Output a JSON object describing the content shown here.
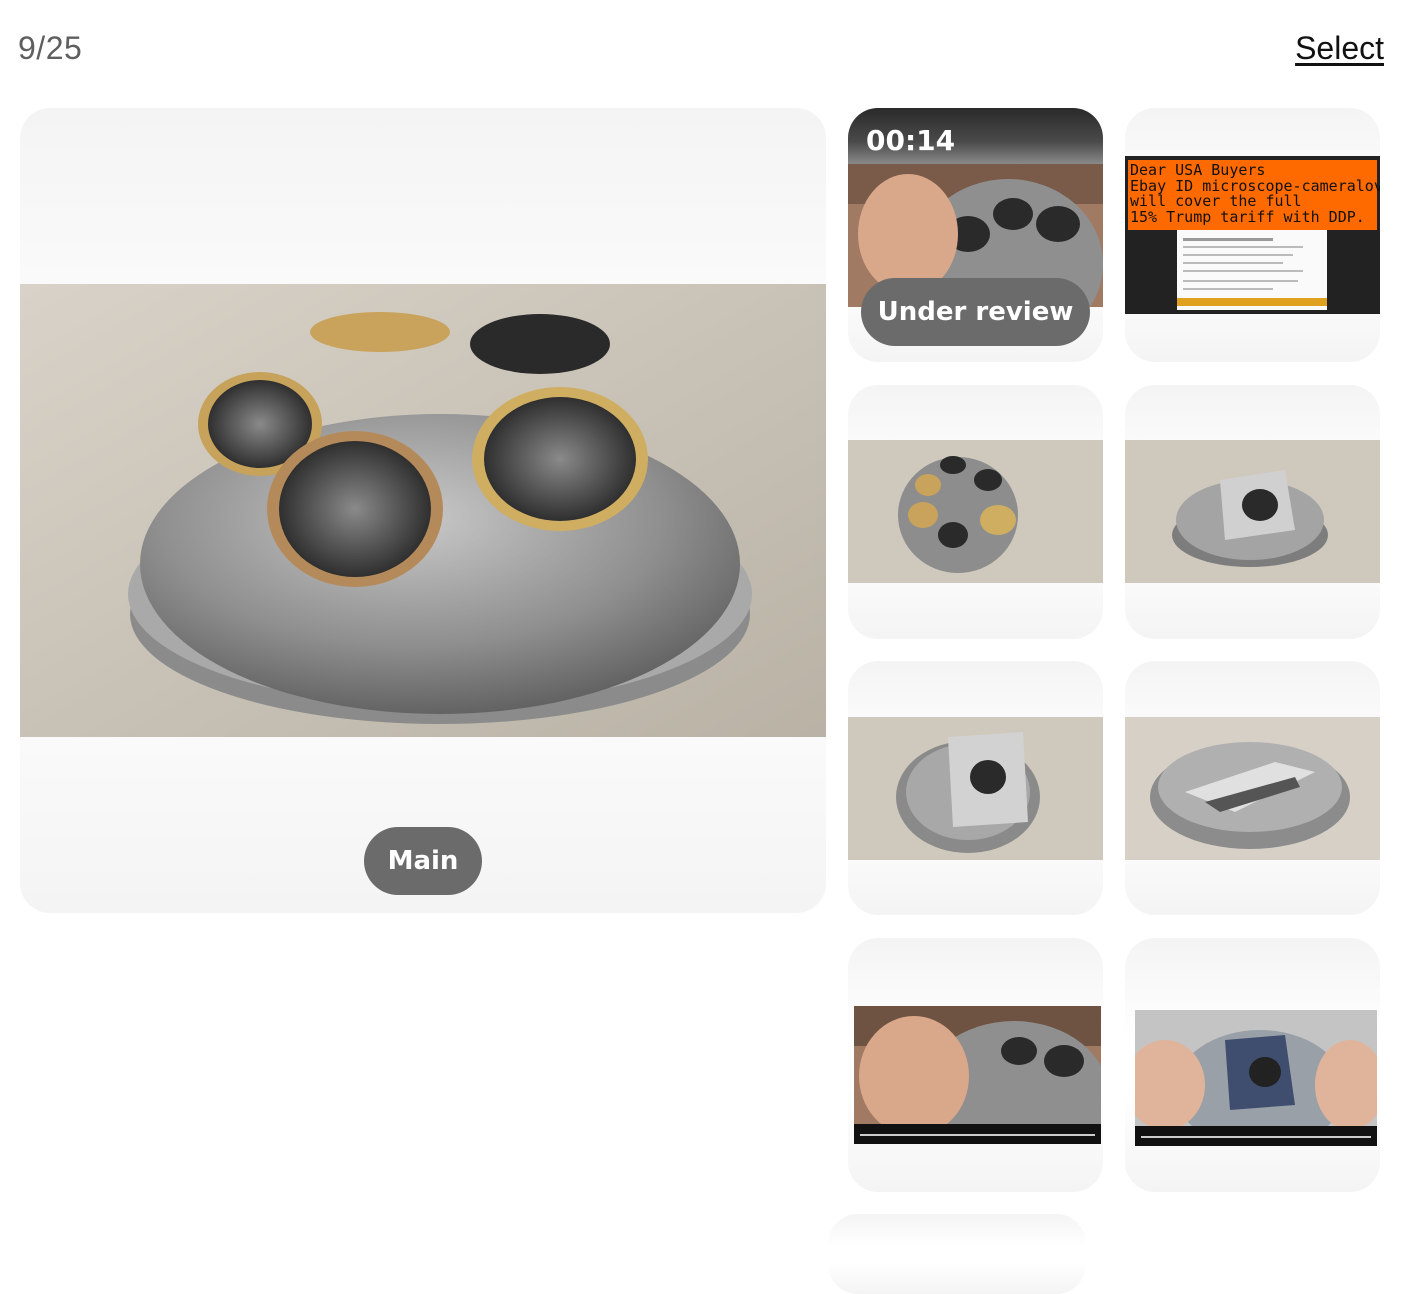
{
  "header": {
    "counter": "9/25",
    "select_label": "Select"
  },
  "main_photo": {
    "badge": "Main"
  },
  "video_thumb": {
    "duration": "00:14",
    "status": "Under review"
  },
  "notice_thumb": {
    "lines": [
      "Dear USA Buyers",
      "Ebay ID microscope-cameralovelove",
      "will cover the full",
      "15% Trump tariff with DDP."
    ]
  },
  "colors": {
    "badge_bg": "#6b6b6b",
    "notice_orange": "#ff6a00"
  }
}
